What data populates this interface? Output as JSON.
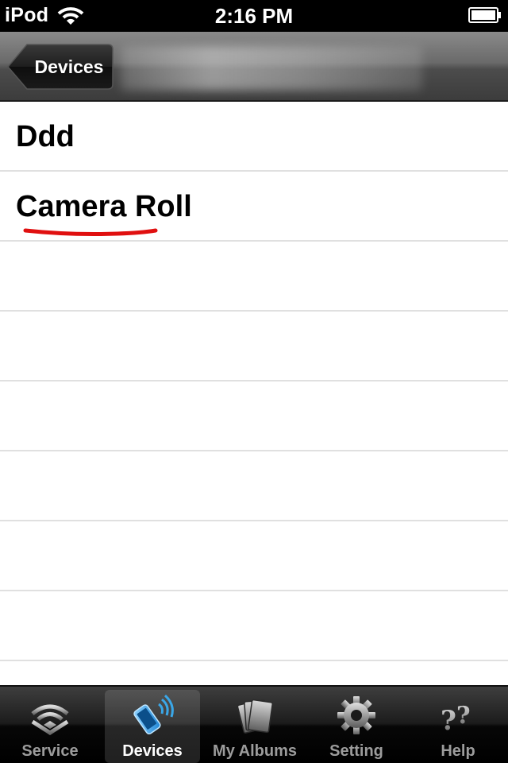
{
  "status_bar": {
    "carrier": "iPod",
    "time": "2:16 PM"
  },
  "nav": {
    "back_label": "Devices"
  },
  "list": {
    "items": [
      {
        "label": "Ddd"
      },
      {
        "label": "Camera Roll"
      }
    ]
  },
  "tabs": [
    {
      "label": "Service",
      "icon": "wifi-stack-icon",
      "selected": false
    },
    {
      "label": "Devices",
      "icon": "device-signal-icon",
      "selected": true
    },
    {
      "label": "My Albums",
      "icon": "albums-icon",
      "selected": false
    },
    {
      "label": "Setting",
      "icon": "gear-icon",
      "selected": false
    },
    {
      "label": "Help",
      "icon": "question-icon",
      "selected": false
    }
  ],
  "colors": {
    "annotation": "#e01010",
    "selected_tab_icon": "#3aa7e8"
  }
}
